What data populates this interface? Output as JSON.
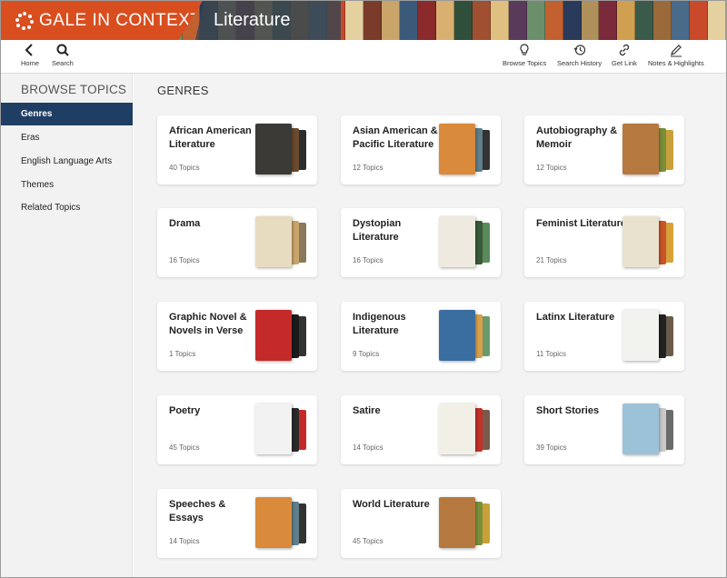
{
  "header": {
    "brand": "GALE IN CONTEXT",
    "product": "Literature"
  },
  "toolbar": {
    "left": [
      {
        "label": "Home",
        "icon": "chevron-left-icon"
      },
      {
        "label": "Search",
        "icon": "search-icon"
      }
    ],
    "right": [
      {
        "label": "Browse Topics",
        "icon": "lightbulb-icon"
      },
      {
        "label": "Search History",
        "icon": "history-icon"
      },
      {
        "label": "Get Link",
        "icon": "link-icon"
      },
      {
        "label": "Notes & Highlights",
        "icon": "pen-icon"
      }
    ]
  },
  "sidebar": {
    "title": "BROWSE TOPICS",
    "items": [
      {
        "label": "Genres",
        "active": true
      },
      {
        "label": "Eras"
      },
      {
        "label": "English Language Arts"
      },
      {
        "label": "Themes"
      },
      {
        "label": "Related Topics"
      }
    ]
  },
  "main": {
    "title": "GENRES",
    "cards": [
      {
        "name": "African American Literature",
        "count": "40 Topics",
        "colors": [
          "#3b3a36",
          "#6b4a2e",
          "#2d2d2d"
        ]
      },
      {
        "name": "Asian American & Pacific Literature",
        "count": "12 Topics",
        "colors": [
          "#d98a3a",
          "#5f7f8a",
          "#333"
        ]
      },
      {
        "name": "Autobiography & Memoir",
        "count": "12 Topics",
        "colors": [
          "#b5793f",
          "#7a8f3a",
          "#c8a03a"
        ]
      },
      {
        "name": "Drama",
        "count": "16 Topics",
        "colors": [
          "#e8dcc0",
          "#c9a56a",
          "#8a7a5a"
        ]
      },
      {
        "name": "Dystopian Literature",
        "count": "16 Topics",
        "colors": [
          "#eeeae0",
          "#3a5a3a",
          "#5a8a5a"
        ]
      },
      {
        "name": "Feminist Literature",
        "count": "21 Topics",
        "colors": [
          "#e9e2cf",
          "#c9542a",
          "#d9a03a"
        ]
      },
      {
        "name": "Graphic Novel & Novels in Verse",
        "count": "1 Topics",
        "colors": [
          "#c42a2a",
          "#1a1a1a",
          "#333"
        ]
      },
      {
        "name": "Indigenous Literature",
        "count": "9 Topics",
        "colors": [
          "#3b6ea0",
          "#d9a04a",
          "#6a9a6a"
        ]
      },
      {
        "name": "Latinx Literature",
        "count": "11 Topics",
        "colors": [
          "#f2f2ee",
          "#222",
          "#6a5a4a"
        ]
      },
      {
        "name": "Poetry",
        "count": "45 Topics",
        "colors": [
          "#f2f2f2",
          "#2a2a2a",
          "#c42a2a"
        ]
      },
      {
        "name": "Satire",
        "count": "14 Topics",
        "colors": [
          "#f2efe6",
          "#c4302a",
          "#7a5a4a"
        ]
      },
      {
        "name": "Short Stories",
        "count": "39 Topics",
        "colors": [
          "#9cc2d8",
          "#c9c9c9",
          "#6a6a6a"
        ]
      },
      {
        "name": "Speeches & Essays",
        "count": "14 Topics",
        "colors": [
          "#d98a3a",
          "#5f7f8a",
          "#333"
        ]
      },
      {
        "name": "World Literature",
        "count": "45 Topics",
        "colors": [
          "#b5793f",
          "#7a8f3a",
          "#c8a03a"
        ]
      }
    ]
  }
}
